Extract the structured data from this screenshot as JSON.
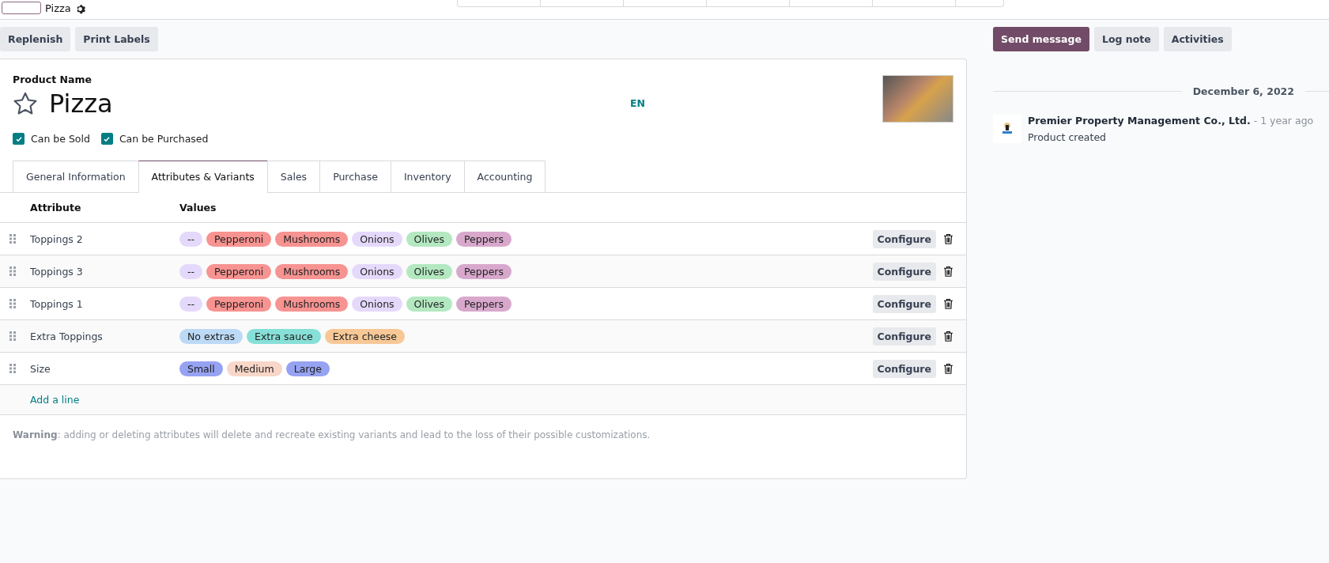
{
  "breadcrumb": {
    "record": "Pizza"
  },
  "actions": [
    "Replenish",
    "Print Labels"
  ],
  "form": {
    "name_label": "Product Name",
    "name": "Pizza",
    "favorite": false,
    "language": "EN",
    "flags": [
      {
        "label": "Can be Sold",
        "checked": true
      },
      {
        "label": "Can be Purchased",
        "checked": true
      }
    ],
    "tabs": [
      {
        "label": "General Information",
        "selected": false
      },
      {
        "label": "Attributes & Variants",
        "selected": true
      },
      {
        "label": "Sales",
        "selected": false
      },
      {
        "label": "Purchase",
        "selected": false
      },
      {
        "label": "Inventory",
        "selected": false
      },
      {
        "label": "Accounting",
        "selected": false
      }
    ],
    "table": {
      "columns": [
        "Attribute",
        "Values"
      ],
      "rows": [
        {
          "attribute": "Toppings 2",
          "values": [
            {
              "label": "--",
              "color": "#e5d9fb"
            },
            {
              "label": "Pepperoni",
              "color": "#f79391"
            },
            {
              "label": "Mushrooms",
              "color": "#f79391"
            },
            {
              "label": "Onions",
              "color": "#e5d9fb"
            },
            {
              "label": "Olives",
              "color": "#b3e8c0"
            },
            {
              "label": "Peppers",
              "color": "#d8a8cc"
            }
          ],
          "button": "Configure"
        },
        {
          "attribute": "Toppings 3",
          "values": [
            {
              "label": "--",
              "color": "#e5d9fb"
            },
            {
              "label": "Pepperoni",
              "color": "#f79391"
            },
            {
              "label": "Mushrooms",
              "color": "#f79391"
            },
            {
              "label": "Onions",
              "color": "#e5d9fb"
            },
            {
              "label": "Olives",
              "color": "#b3e8c0"
            },
            {
              "label": "Peppers",
              "color": "#d8a8cc"
            }
          ],
          "button": "Configure"
        },
        {
          "attribute": "Toppings 1",
          "values": [
            {
              "label": "--",
              "color": "#e5d9fb"
            },
            {
              "label": "Pepperoni",
              "color": "#f79391"
            },
            {
              "label": "Mushrooms",
              "color": "#f79391"
            },
            {
              "label": "Onions",
              "color": "#e5d9fb"
            },
            {
              "label": "Olives",
              "color": "#b3e8c0"
            },
            {
              "label": "Peppers",
              "color": "#d8a8cc"
            }
          ],
          "button": "Configure"
        },
        {
          "attribute": "Extra Toppings",
          "values": [
            {
              "label": "No extras",
              "color": "#bcd9f5"
            },
            {
              "label": "Extra sauce",
              "color": "#87e0d8"
            },
            {
              "label": "Extra cheese",
              "color": "#f7c896"
            }
          ],
          "button": "Configure"
        },
        {
          "attribute": "Size",
          "values": [
            {
              "label": "Small",
              "color": "#96a2f2"
            },
            {
              "label": "Medium",
              "color": "#f8d6c8"
            },
            {
              "label": "Large",
              "color": "#96a2f2"
            }
          ],
          "button": "Configure"
        }
      ],
      "add_line": "Add a line"
    },
    "warning": "**Warning**: adding or deleting attributes will delete and recreate existing variants and lead to the loss of their possible customizations."
  },
  "chatter": {
    "buttons": [
      {
        "label": "Send message",
        "selected": true
      },
      {
        "label": "Log note",
        "selected": false
      },
      {
        "label": "Activities",
        "selected": false
      }
    ],
    "date": "December 6, 2022",
    "messages": [
      {
        "author": "Premier Property Management Co., Ltd.",
        "time": "- 1 year ago",
        "body": "Product created"
      }
    ]
  }
}
